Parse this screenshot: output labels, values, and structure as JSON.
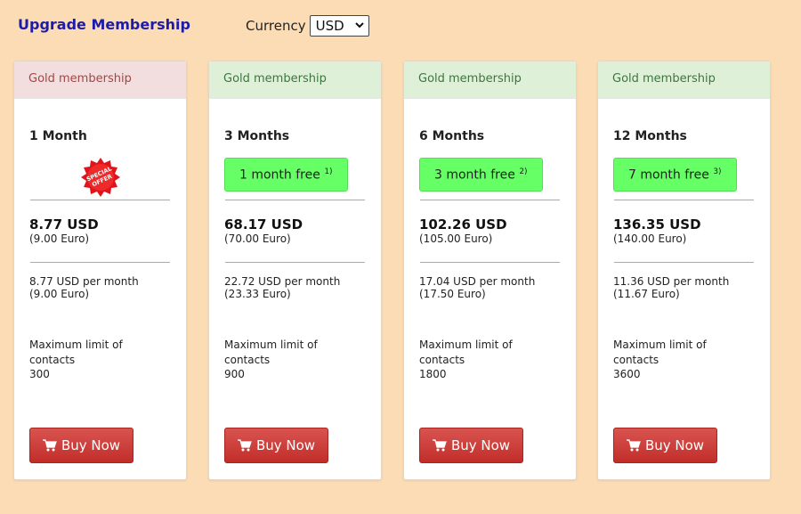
{
  "header": {
    "title": "Upgrade Membership",
    "currency_label": "Currency",
    "currency_value": "USD"
  },
  "colors": {
    "background": "#fcdcb4",
    "title": "#1c1ca8",
    "button": "#d9534f",
    "free_badge": "#66ff66",
    "header_red": "#f2dede",
    "header_green": "#dff0d8"
  },
  "plans": [
    {
      "header": "Gold membership",
      "duration": "1 Month",
      "badge_icon": "special-offer-icon",
      "badge_text": "SPECIAL OFFER",
      "price": "8.77 USD",
      "price_euro": "(9.00 Euro)",
      "monthly": "8.77 USD per month",
      "monthly_euro": "(9.00 Euro)",
      "limit_label": "Maximum limit of contacts",
      "limit_value": "300",
      "buy_label": "Buy Now"
    },
    {
      "header": "Gold membership",
      "duration": "3 Months",
      "free_text": "1 month free",
      "free_note": "1)",
      "price": "68.17 USD",
      "price_euro": "(70.00 Euro)",
      "monthly": "22.72 USD per month",
      "monthly_euro": "(23.33 Euro)",
      "limit_label": "Maximum limit of contacts",
      "limit_value": "900",
      "buy_label": "Buy Now"
    },
    {
      "header": "Gold membership",
      "duration": "6 Months",
      "free_text": "3 month free",
      "free_note": "2)",
      "price": "102.26 USD",
      "price_euro": "(105.00 Euro)",
      "monthly": "17.04 USD per month",
      "monthly_euro": "(17.50 Euro)",
      "limit_label": "Maximum limit of contacts",
      "limit_value": "1800",
      "buy_label": "Buy Now"
    },
    {
      "header": "Gold membership",
      "duration": "12 Months",
      "free_text": "7 month free",
      "free_note": "3)",
      "price": "136.35 USD",
      "price_euro": "(140.00 Euro)",
      "monthly": "11.36 USD per month",
      "monthly_euro": "(11.67 Euro)",
      "limit_label": "Maximum limit of contacts",
      "limit_value": "3600",
      "buy_label": "Buy Now"
    }
  ]
}
